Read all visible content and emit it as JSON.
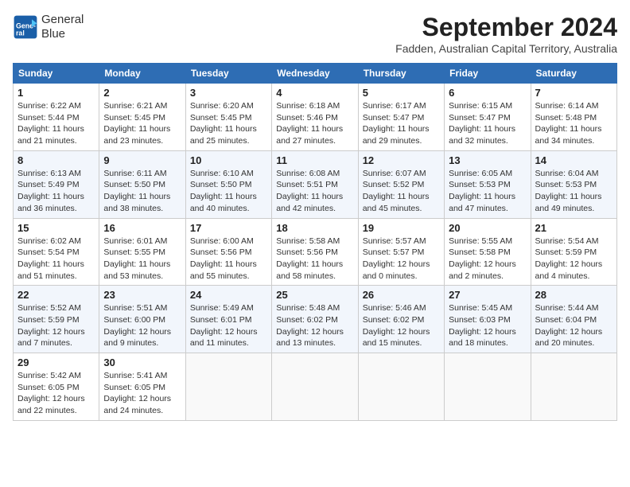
{
  "header": {
    "logo_line1": "General",
    "logo_line2": "Blue",
    "month": "September 2024",
    "location": "Fadden, Australian Capital Territory, Australia"
  },
  "days_of_week": [
    "Sunday",
    "Monday",
    "Tuesday",
    "Wednesday",
    "Thursday",
    "Friday",
    "Saturday"
  ],
  "weeks": [
    [
      {
        "day": 1,
        "sunrise": "6:22 AM",
        "sunset": "5:44 PM",
        "daylight": "11 hours and 21 minutes."
      },
      {
        "day": 2,
        "sunrise": "6:21 AM",
        "sunset": "5:45 PM",
        "daylight": "11 hours and 23 minutes."
      },
      {
        "day": 3,
        "sunrise": "6:20 AM",
        "sunset": "5:45 PM",
        "daylight": "11 hours and 25 minutes."
      },
      {
        "day": 4,
        "sunrise": "6:18 AM",
        "sunset": "5:46 PM",
        "daylight": "11 hours and 27 minutes."
      },
      {
        "day": 5,
        "sunrise": "6:17 AM",
        "sunset": "5:47 PM",
        "daylight": "11 hours and 29 minutes."
      },
      {
        "day": 6,
        "sunrise": "6:15 AM",
        "sunset": "5:47 PM",
        "daylight": "11 hours and 32 minutes."
      },
      {
        "day": 7,
        "sunrise": "6:14 AM",
        "sunset": "5:48 PM",
        "daylight": "11 hours and 34 minutes."
      }
    ],
    [
      {
        "day": 8,
        "sunrise": "6:13 AM",
        "sunset": "5:49 PM",
        "daylight": "11 hours and 36 minutes."
      },
      {
        "day": 9,
        "sunrise": "6:11 AM",
        "sunset": "5:50 PM",
        "daylight": "11 hours and 38 minutes."
      },
      {
        "day": 10,
        "sunrise": "6:10 AM",
        "sunset": "5:50 PM",
        "daylight": "11 hours and 40 minutes."
      },
      {
        "day": 11,
        "sunrise": "6:08 AM",
        "sunset": "5:51 PM",
        "daylight": "11 hours and 42 minutes."
      },
      {
        "day": 12,
        "sunrise": "6:07 AM",
        "sunset": "5:52 PM",
        "daylight": "11 hours and 45 minutes."
      },
      {
        "day": 13,
        "sunrise": "6:05 AM",
        "sunset": "5:53 PM",
        "daylight": "11 hours and 47 minutes."
      },
      {
        "day": 14,
        "sunrise": "6:04 AM",
        "sunset": "5:53 PM",
        "daylight": "11 hours and 49 minutes."
      }
    ],
    [
      {
        "day": 15,
        "sunrise": "6:02 AM",
        "sunset": "5:54 PM",
        "daylight": "11 hours and 51 minutes."
      },
      {
        "day": 16,
        "sunrise": "6:01 AM",
        "sunset": "5:55 PM",
        "daylight": "11 hours and 53 minutes."
      },
      {
        "day": 17,
        "sunrise": "6:00 AM",
        "sunset": "5:56 PM",
        "daylight": "11 hours and 55 minutes."
      },
      {
        "day": 18,
        "sunrise": "5:58 AM",
        "sunset": "5:56 PM",
        "daylight": "11 hours and 58 minutes."
      },
      {
        "day": 19,
        "sunrise": "5:57 AM",
        "sunset": "5:57 PM",
        "daylight": "12 hours and 0 minutes."
      },
      {
        "day": 20,
        "sunrise": "5:55 AM",
        "sunset": "5:58 PM",
        "daylight": "12 hours and 2 minutes."
      },
      {
        "day": 21,
        "sunrise": "5:54 AM",
        "sunset": "5:59 PM",
        "daylight": "12 hours and 4 minutes."
      }
    ],
    [
      {
        "day": 22,
        "sunrise": "5:52 AM",
        "sunset": "5:59 PM",
        "daylight": "12 hours and 7 minutes."
      },
      {
        "day": 23,
        "sunrise": "5:51 AM",
        "sunset": "6:00 PM",
        "daylight": "12 hours and 9 minutes."
      },
      {
        "day": 24,
        "sunrise": "5:49 AM",
        "sunset": "6:01 PM",
        "daylight": "12 hours and 11 minutes."
      },
      {
        "day": 25,
        "sunrise": "5:48 AM",
        "sunset": "6:02 PM",
        "daylight": "12 hours and 13 minutes."
      },
      {
        "day": 26,
        "sunrise": "5:46 AM",
        "sunset": "6:02 PM",
        "daylight": "12 hours and 15 minutes."
      },
      {
        "day": 27,
        "sunrise": "5:45 AM",
        "sunset": "6:03 PM",
        "daylight": "12 hours and 18 minutes."
      },
      {
        "day": 28,
        "sunrise": "5:44 AM",
        "sunset": "6:04 PM",
        "daylight": "12 hours and 20 minutes."
      }
    ],
    [
      {
        "day": 29,
        "sunrise": "5:42 AM",
        "sunset": "6:05 PM",
        "daylight": "12 hours and 22 minutes."
      },
      {
        "day": 30,
        "sunrise": "5:41 AM",
        "sunset": "6:05 PM",
        "daylight": "12 hours and 24 minutes."
      },
      null,
      null,
      null,
      null,
      null
    ]
  ]
}
